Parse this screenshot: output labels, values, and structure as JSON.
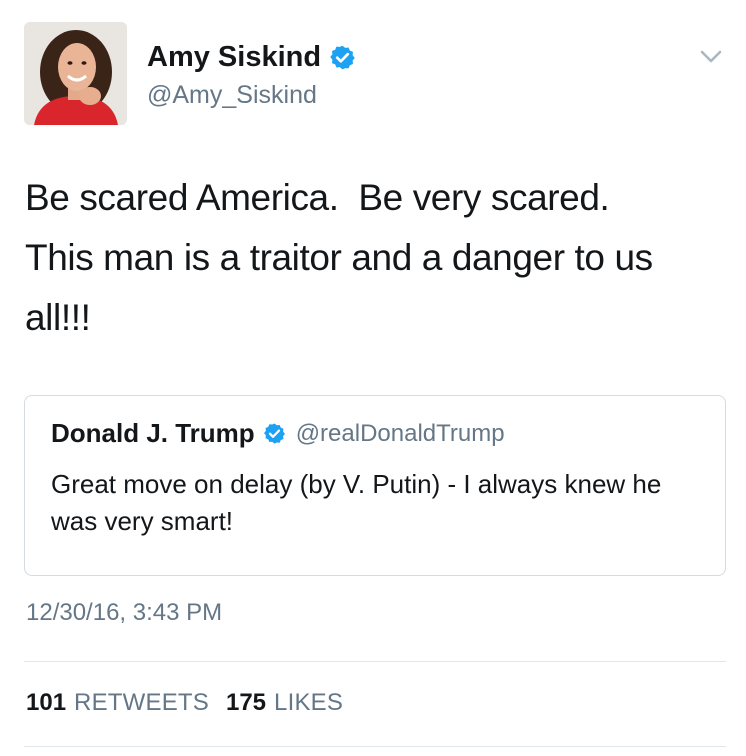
{
  "author": {
    "name": "Amy Siskind",
    "handle": "@Amy_Siskind",
    "verified": true
  },
  "tweet": {
    "text": "Be scared America.  Be very scared.\nThis man is a traitor and a danger to us all!!!",
    "timestamp": "12/30/16, 3:43 PM"
  },
  "quoted_tweet": {
    "name": "Donald J. Trump",
    "handle": "@realDonaldTrump",
    "verified": true,
    "text": "Great move on delay (by V. Putin) - I always knew he was very smart!"
  },
  "stats": {
    "retweets_count": "101",
    "retweets_label": "RETWEETS",
    "likes_count": "175",
    "likes_label": "LIKES"
  },
  "icons": {
    "verified": "verified-badge-icon",
    "menu": "chevron-down-icon"
  },
  "colors": {
    "verified_blue": "#1da1f2",
    "text_primary": "#14171a",
    "text_secondary": "#657786",
    "border": "#d6dbe0"
  }
}
